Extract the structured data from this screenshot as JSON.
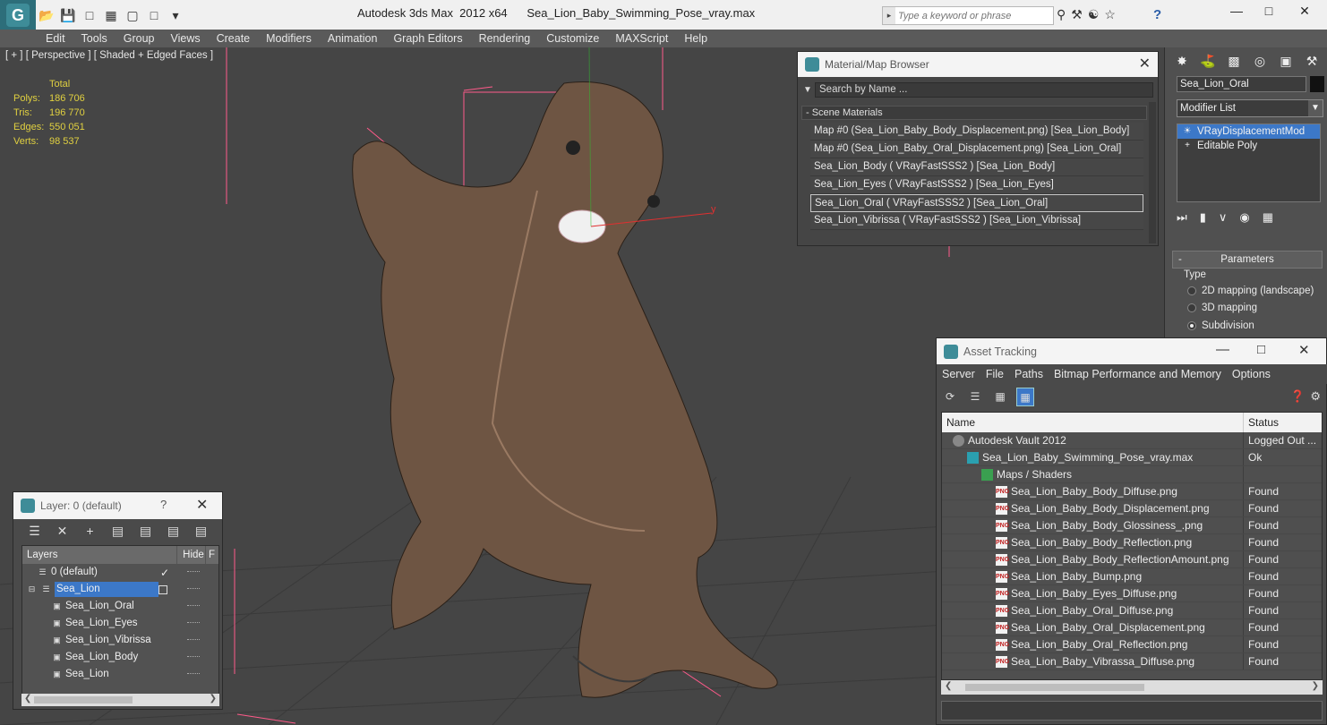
{
  "titlebar": {
    "app_title": "Autodesk 3ds Max  2012 x64",
    "file_name": "Sea_Lion_Baby_Swimming_Pose_vray.max",
    "search_placeholder": "Type a keyword or phrase"
  },
  "menu": [
    "Edit",
    "Tools",
    "Group",
    "Views",
    "Create",
    "Modifiers",
    "Animation",
    "Graph Editors",
    "Rendering",
    "Customize",
    "MAXScript",
    "Help"
  ],
  "viewport": {
    "label": "[ + ] [ Perspective ] [ Shaded + Edged Faces ]",
    "stats": {
      "header": "Total",
      "rows": [
        {
          "label": "Polys:",
          "value": "186 706"
        },
        {
          "label": "Tris:",
          "value": "196 770"
        },
        {
          "label": "Edges:",
          "value": "550 051"
        },
        {
          "label": "Verts:",
          "value": "98 537"
        }
      ]
    },
    "axis_label_y": "y"
  },
  "material_browser": {
    "title": "Material/Map Browser",
    "search_placeholder": "Search by Name ...",
    "section": "- Scene Materials",
    "items": [
      "Map #0 (Sea_Lion_Baby_Body_Displacement.png) [Sea_Lion_Body]",
      "Map #0 (Sea_Lion_Baby_Oral_Displacement.png) [Sea_Lion_Oral]",
      "Sea_Lion_Body  ( VRayFastSSS2 )  [Sea_Lion_Body]",
      "Sea_Lion_Eyes  ( VRayFastSSS2 )  [Sea_Lion_Eyes]",
      "Sea_Lion_Oral  ( VRayFastSSS2 )  [Sea_Lion_Oral]",
      "Sea_Lion_Vibrissa  ( VRayFastSSS2 )  [Sea_Lion_Vibrissa]"
    ],
    "selected_index": 4
  },
  "command_panel": {
    "object_name": "Sea_Lion_Oral",
    "modifier_list": "Modifier List",
    "stack": [
      "VRayDisplacementMod",
      "Editable Poly"
    ],
    "parameters_label": "Parameters",
    "type_label": "Type",
    "radios": [
      "2D mapping (landscape)",
      "3D mapping",
      "Subdivision"
    ],
    "selected_radio": 2
  },
  "layer_dialog": {
    "title": "Layer: 0 (default)",
    "help": "?",
    "columns": [
      "Layers",
      "Hide",
      "F"
    ],
    "rows": [
      {
        "name": "0 (default)",
        "kind": "layer",
        "indent": 1
      },
      {
        "name": "Sea_Lion",
        "kind": "layer",
        "indent": 0
      },
      {
        "name": "Sea_Lion_Oral",
        "kind": "object",
        "indent": 2
      },
      {
        "name": "Sea_Lion_Eyes",
        "kind": "object",
        "indent": 2
      },
      {
        "name": "Sea_Lion_Vibrissa",
        "kind": "object",
        "indent": 2
      },
      {
        "name": "Sea_Lion_Body",
        "kind": "object",
        "indent": 2
      },
      {
        "name": "Sea_Lion",
        "kind": "object",
        "indent": 2
      }
    ]
  },
  "asset_tracking": {
    "title": "Asset Tracking",
    "menu": [
      "Server",
      "File",
      "Paths",
      "Bitmap Performance and Memory",
      "Options"
    ],
    "columns": [
      "Name",
      "Status"
    ],
    "rows": [
      {
        "name": "Autodesk Vault 2012",
        "status": "Logged Out ...",
        "icon": "vault",
        "indent": 1
      },
      {
        "name": "Sea_Lion_Baby_Swimming_Pose_vray.max",
        "status": "Ok",
        "icon": "max",
        "indent": 2
      },
      {
        "name": "Maps / Shaders",
        "status": "",
        "icon": "maps",
        "indent": 3
      },
      {
        "name": "Sea_Lion_Baby_Body_Diffuse.png",
        "status": "Found",
        "icon": "png",
        "indent": 4
      },
      {
        "name": "Sea_Lion_Baby_Body_Displacement.png",
        "status": "Found",
        "icon": "png",
        "indent": 4
      },
      {
        "name": "Sea_Lion_Baby_Body_Glossiness_.png",
        "status": "Found",
        "icon": "png",
        "indent": 4
      },
      {
        "name": "Sea_Lion_Baby_Body_Reflection.png",
        "status": "Found",
        "icon": "png",
        "indent": 4
      },
      {
        "name": "Sea_Lion_Baby_Body_ReflectionAmount.png",
        "status": "Found",
        "icon": "png",
        "indent": 4
      },
      {
        "name": "Sea_Lion_Baby_Bump.png",
        "status": "Found",
        "icon": "png",
        "indent": 4
      },
      {
        "name": "Sea_Lion_Baby_Eyes_Diffuse.png",
        "status": "Found",
        "icon": "png",
        "indent": 4
      },
      {
        "name": "Sea_Lion_Baby_Oral_Diffuse.png",
        "status": "Found",
        "icon": "png",
        "indent": 4
      },
      {
        "name": "Sea_Lion_Baby_Oral_Displacement.png",
        "status": "Found",
        "icon": "png",
        "indent": 4
      },
      {
        "name": "Sea_Lion_Baby_Oral_Reflection.png",
        "status": "Found",
        "icon": "png",
        "indent": 4
      },
      {
        "name": "Sea_Lion_Baby_Vibrassa_Diffuse.png",
        "status": "Found",
        "icon": "png",
        "indent": 4
      }
    ]
  },
  "colors": {
    "selection": "#3c78c8",
    "stats_text": "#e0d040",
    "viewport_bg": "#454545"
  }
}
